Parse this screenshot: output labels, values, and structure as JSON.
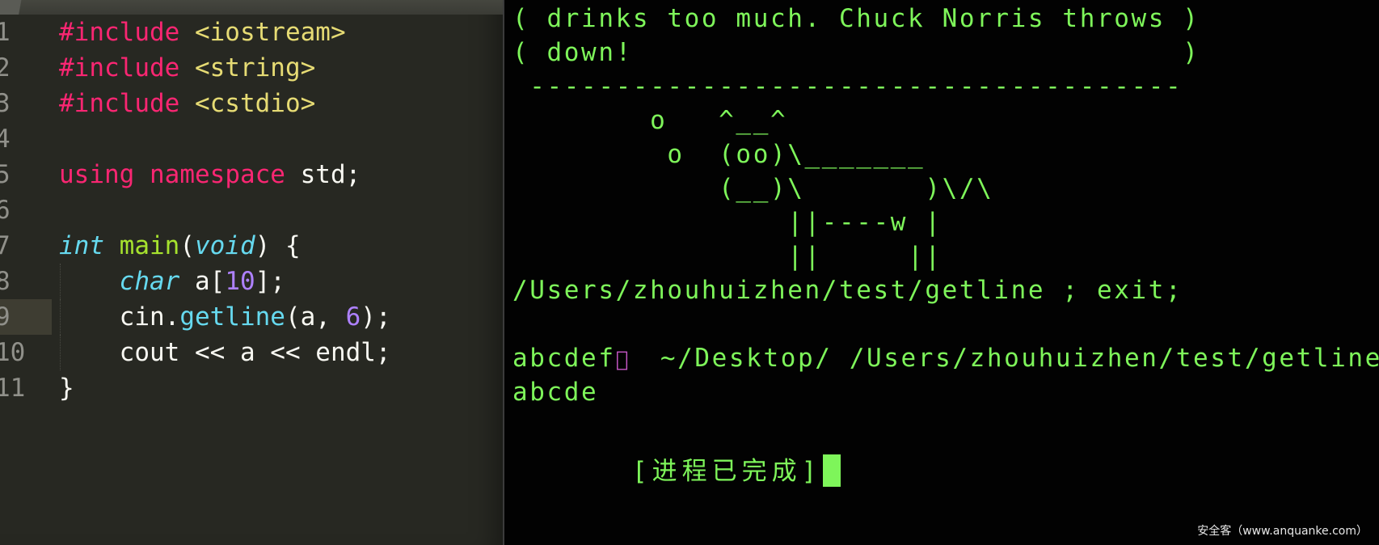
{
  "editor": {
    "language": "C++",
    "current_line": 9,
    "lines": [
      {
        "num": "1",
        "tokens": [
          {
            "t": "#include",
            "c": "kw"
          },
          {
            "t": " ",
            "c": "pl"
          },
          {
            "t": "<iostream>",
            "c": "str"
          }
        ]
      },
      {
        "num": "2",
        "tokens": [
          {
            "t": "#include",
            "c": "kw"
          },
          {
            "t": " ",
            "c": "pl"
          },
          {
            "t": "<string>",
            "c": "str"
          }
        ]
      },
      {
        "num": "3",
        "tokens": [
          {
            "t": "#include",
            "c": "kw"
          },
          {
            "t": " ",
            "c": "pl"
          },
          {
            "t": "<cstdio>",
            "c": "str"
          }
        ]
      },
      {
        "num": "4",
        "tokens": []
      },
      {
        "num": "5",
        "tokens": [
          {
            "t": "using",
            "c": "kw"
          },
          {
            "t": " ",
            "c": "pl"
          },
          {
            "t": "namespace",
            "c": "kw"
          },
          {
            "t": " std;",
            "c": "pl"
          }
        ]
      },
      {
        "num": "6",
        "tokens": []
      },
      {
        "num": "7",
        "tokens": [
          {
            "t": "int",
            "c": "type"
          },
          {
            "t": " ",
            "c": "pl"
          },
          {
            "t": "main",
            "c": "fn"
          },
          {
            "t": "(",
            "c": "pl"
          },
          {
            "t": "void",
            "c": "type"
          },
          {
            "t": ") {",
            "c": "pl"
          }
        ]
      },
      {
        "num": "8",
        "guide": true,
        "tokens": [
          {
            "t": "    ",
            "c": "pl"
          },
          {
            "t": "char",
            "c": "type"
          },
          {
            "t": " a[",
            "c": "pl"
          },
          {
            "t": "10",
            "c": "num"
          },
          {
            "t": "];",
            "c": "pl"
          }
        ]
      },
      {
        "num": "9",
        "guide": true,
        "tokens": [
          {
            "t": "    cin.",
            "c": "pl"
          },
          {
            "t": "getline",
            "c": "call"
          },
          {
            "t": "(a, ",
            "c": "pl"
          },
          {
            "t": "6",
            "c": "num"
          },
          {
            "t": ");",
            "c": "pl"
          }
        ]
      },
      {
        "num": "10",
        "guide": true,
        "tokens": [
          {
            "t": "    cout << a << endl;",
            "c": "pl"
          }
        ]
      },
      {
        "num": "11",
        "tokens": [
          {
            "t": "}",
            "c": "pl"
          }
        ]
      }
    ]
  },
  "terminal": {
    "lines": [
      "( drinks too much. Chuck Norris throws )",
      "( down!                                )",
      " --------------------------------------",
      "        o   ^__^",
      "         o  (oo)\\_______",
      "            (__)\\       )\\/\\",
      "                ||----w |",
      "                ||     ||",
      "/Users/zhouhuizhen/test/getline ; exit;"
    ],
    "prompt": {
      "icon": "apple-icon",
      "text": " ~/Desktop/ /Users/zhouhuizhen/test/getline ; exit;"
    },
    "output": [
      "abcdef",
      "abcde",
      ""
    ],
    "status": "[进程已完成]",
    "text_color": "#7ef55a",
    "prompt_icon_color": "#c757c7"
  },
  "watermark": "安全客（www.anquanke.com）"
}
